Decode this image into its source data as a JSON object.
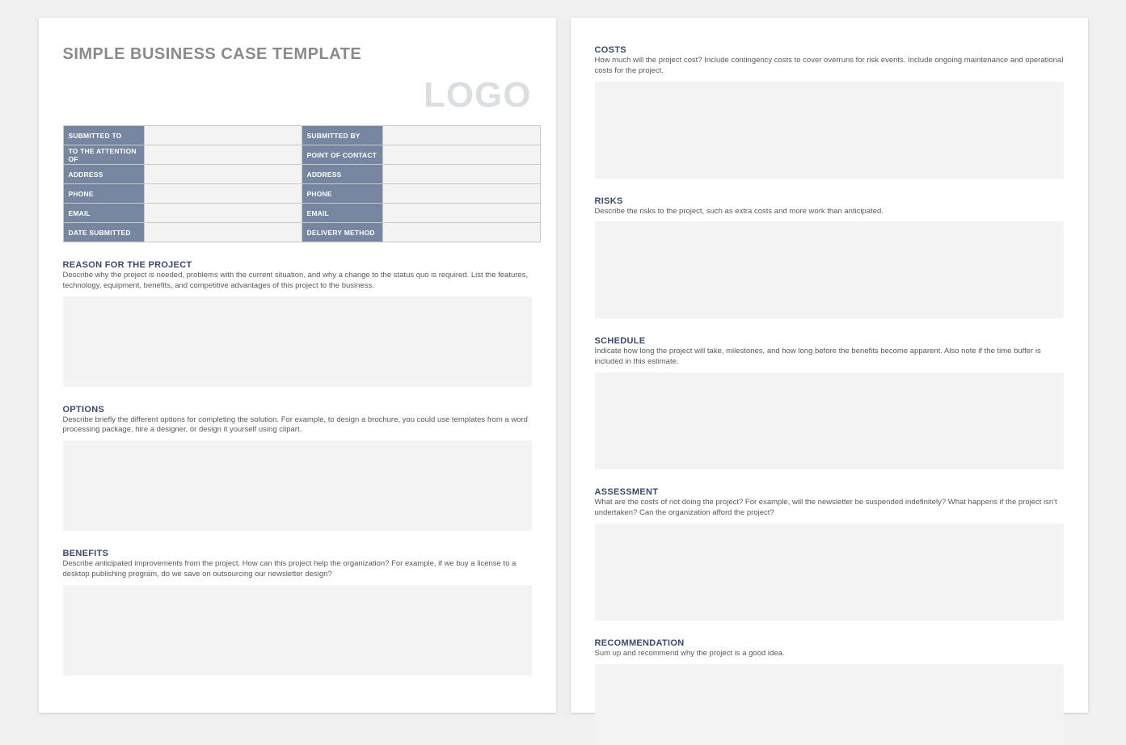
{
  "title": "SIMPLE BUSINESS CASE TEMPLATE",
  "logo_text": "LOGO",
  "info_table": {
    "rows": [
      {
        "left_label": "SUBMITTED TO",
        "right_label": "SUBMITTED BY"
      },
      {
        "left_label": "TO THE ATTENTION OF",
        "right_label": "POINT OF CONTACT"
      },
      {
        "left_label": "ADDRESS",
        "right_label": "ADDRESS"
      },
      {
        "left_label": "PHONE",
        "right_label": "PHONE"
      },
      {
        "left_label": "EMAIL",
        "right_label": "EMAIL"
      },
      {
        "left_label": "DATE SUBMITTED",
        "right_label": "DELIVERY METHOD"
      }
    ]
  },
  "sections_page1": [
    {
      "heading": "REASON FOR THE PROJECT",
      "desc": "Describe why the project is needed, problems with the current situation, and why a change to the status quo is required. List the features, technology, equipment, benefits, and competitive advantages of this project to the business."
    },
    {
      "heading": "OPTIONS",
      "desc": "Describe briefly the different options for completing the solution. For example, to design a brochure, you could use templates from a word processing package, hire a designer, or design it yourself using clipart."
    },
    {
      "heading": "BENEFITS",
      "desc": "Describe anticipated improvements from the project. How can this project help the organization? For example, if we buy a license to a desktop publishing program, do we save on outsourcing our newsletter design?"
    }
  ],
  "sections_page2": [
    {
      "heading": "COSTS",
      "desc": "How much will the project cost? Include contingency costs to cover overruns for risk events. Include ongoing maintenance and operational costs for the project."
    },
    {
      "heading": "RISKS",
      "desc": "Describe the risks to the project, such as extra costs and more work than anticipated."
    },
    {
      "heading": "SCHEDULE",
      "desc": "Indicate how long the project will take, milestones, and how long before the benefits become apparent. Also note if the time buffer is included in this estimate."
    },
    {
      "heading": "ASSESSMENT",
      "desc": "What are the costs of not doing the project? For example, will the newsletter be suspended indefinitely? What happens if the project isn't undertaken? Can the organization afford the project?"
    },
    {
      "heading": "RECOMMENDATION",
      "desc": "Sum up and recommend why the project is a good idea."
    }
  ]
}
